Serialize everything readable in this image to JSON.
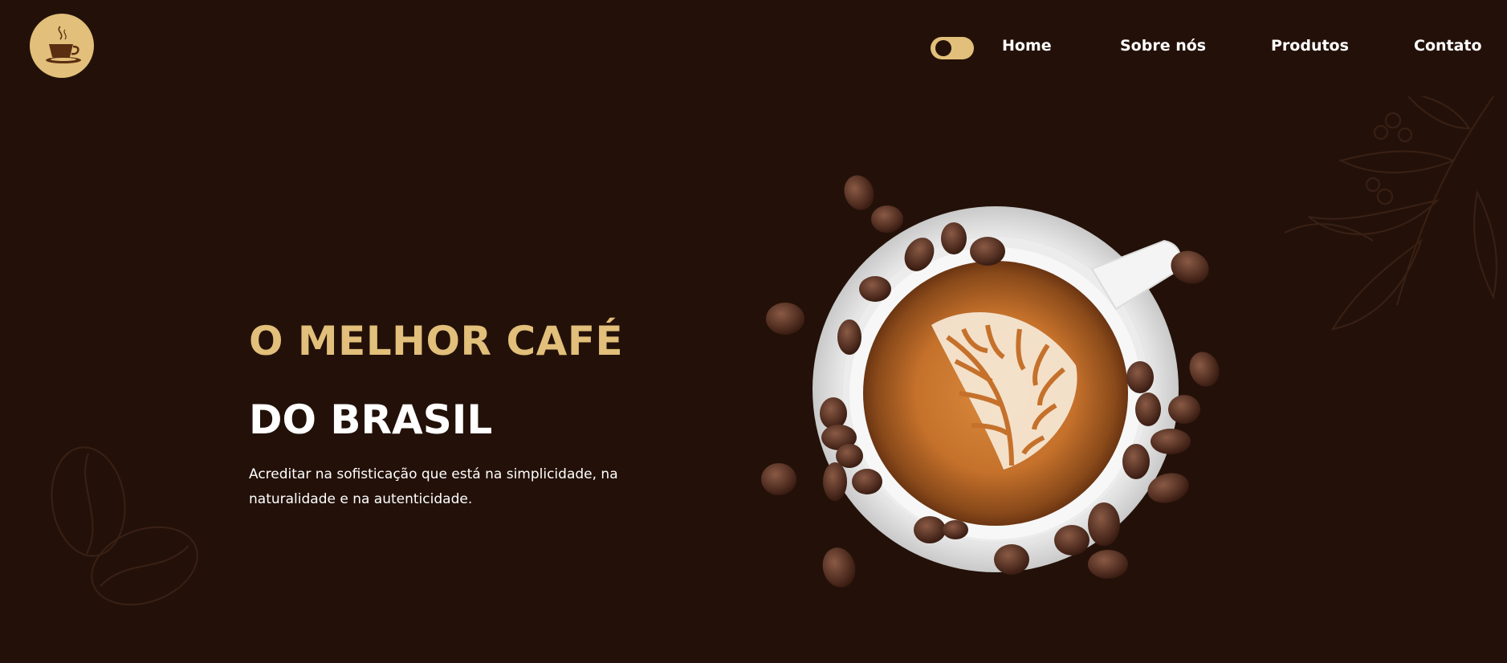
{
  "header": {
    "logo_icon": "coffee-cup-icon",
    "theme_toggle_icon": "toggle-switch-icon",
    "nav": [
      {
        "label": "Home"
      },
      {
        "label": "Sobre nós"
      },
      {
        "label": "Produtos"
      },
      {
        "label": "Contato"
      }
    ]
  },
  "hero": {
    "title_line1": "O MELHOR CAFÉ",
    "title_line2": "DO BRASIL",
    "description": "Acreditar na sofisticação que está na simplicidade, na naturalidade e na autenticidade.",
    "image_icon": "latte-cup-with-beans-image"
  },
  "colors": {
    "background": "#231109",
    "accent": "#e2bf7a",
    "text": "#ffffff"
  }
}
